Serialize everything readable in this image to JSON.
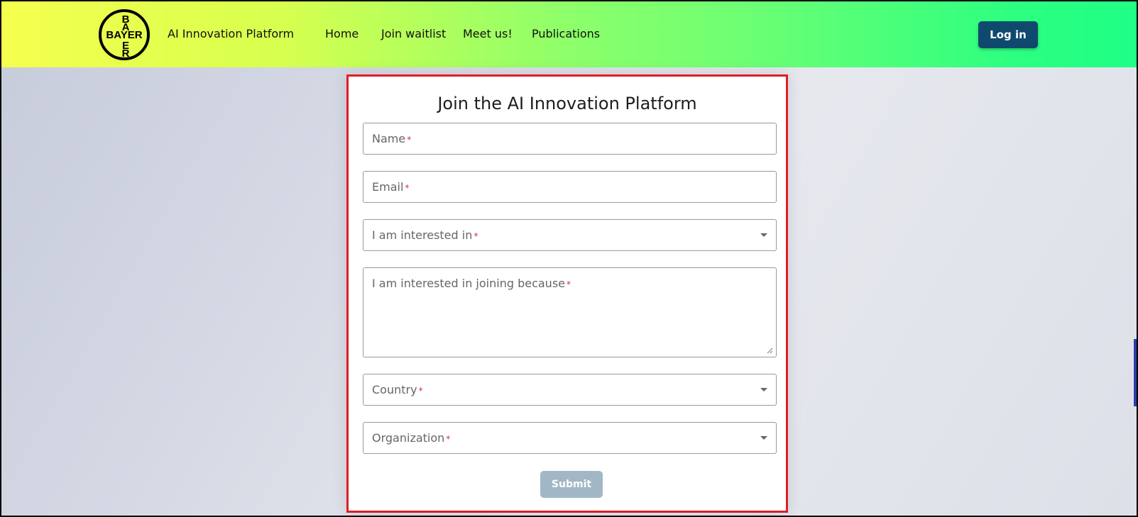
{
  "header": {
    "logo": {
      "vertical_top": "BA",
      "horizontal": "BAYER",
      "vertical_bottom": "ER",
      "icon": "bayer-cross-logo"
    },
    "brand": "AI Innovation Platform",
    "nav": [
      "Home",
      "Join waitlist",
      "Meet us!",
      "Publications"
    ],
    "login_label": "Log in"
  },
  "form": {
    "title": "Join the AI Innovation Platform",
    "fields": [
      {
        "label": "Name",
        "required_mark": "*"
      },
      {
        "label": "Email",
        "required_mark": "*"
      },
      {
        "label": "I am interested in",
        "required_mark": "*",
        "type": "select"
      },
      {
        "label": "I am interested in joining because",
        "required_mark": "*",
        "type": "textarea"
      },
      {
        "label": "Country",
        "required_mark": "*",
        "type": "select"
      },
      {
        "label": "Organization",
        "required_mark": "*",
        "type": "select"
      }
    ],
    "submit_label": "Submit"
  },
  "colors": {
    "accent": "#0f4a6e",
    "highlight_border": "#e31b23",
    "submit_disabled": "#a2b7c6",
    "required": "#d32f2f"
  }
}
